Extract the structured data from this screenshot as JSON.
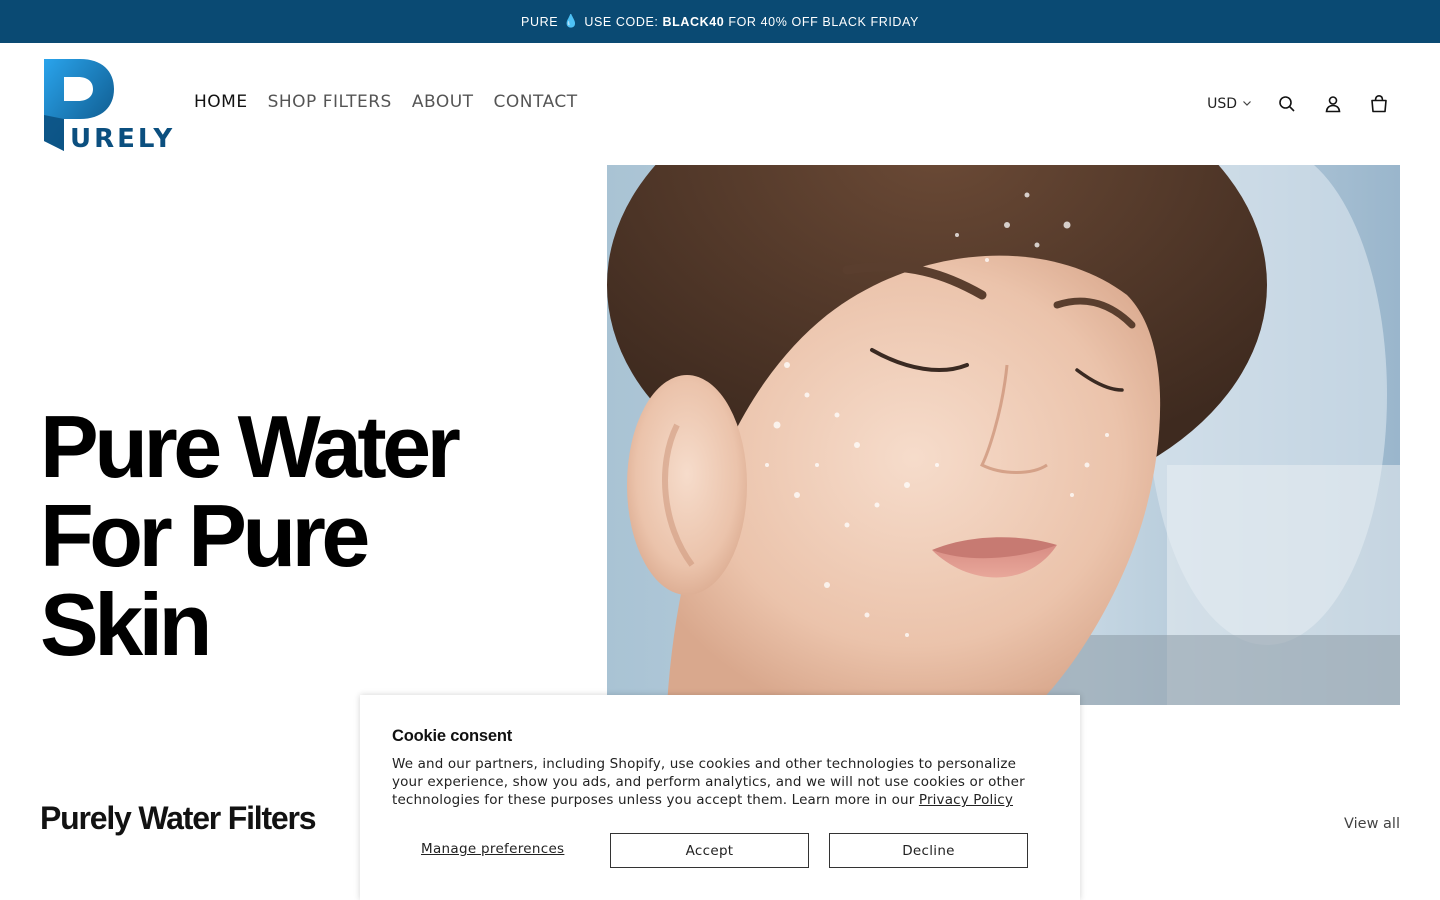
{
  "announcement": {
    "prefix": "PURE",
    "emoji": "💧",
    "text_before": "USE CODE:",
    "code": "BLACK40",
    "text_after": "FOR 40% OFF BLACK FRIDAY"
  },
  "brand": {
    "logo_text": "URELY",
    "logo_letter": "P"
  },
  "nav": {
    "items": [
      {
        "label": "HOME",
        "active": true
      },
      {
        "label": "SHOP FILTERS",
        "active": false
      },
      {
        "label": "ABOUT",
        "active": false
      },
      {
        "label": "CONTACT",
        "active": false
      }
    ]
  },
  "header_tools": {
    "currency": "USD",
    "icons": [
      "chevron-down-icon",
      "search-icon",
      "account-icon",
      "cart-icon"
    ]
  },
  "hero": {
    "title_lines": [
      "Pure Water",
      "For Pure",
      "Skin"
    ]
  },
  "collection": {
    "title": "Purely Water Filters",
    "view_all": "View all"
  },
  "cookie": {
    "title": "Cookie consent",
    "body": "We and our partners, including Shopify, use cookies and other technologies to personalize your experience, show you ads, and perform analytics, and we will not use cookies or other technologies for these purposes unless you accept them. Learn more in our",
    "link": "Privacy Policy",
    "manage": "Manage preferences",
    "accept": "Accept",
    "decline": "Decline"
  },
  "colors": {
    "announcement_bg": "#0a4a73",
    "logo_blue": "#1f8fd8",
    "logo_dark": "#0b4f7f",
    "text": "#121212"
  }
}
